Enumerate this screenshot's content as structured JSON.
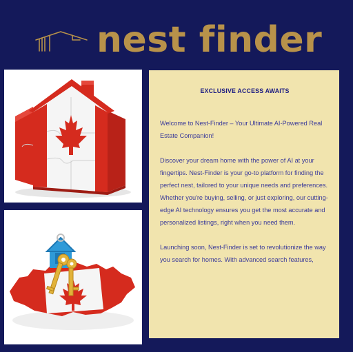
{
  "header": {
    "logo_icon": "house-outline-icon",
    "brand_name": "nest finder"
  },
  "images": [
    {
      "name": "canadian-flag-puzzle-house-image",
      "icon": "puzzle-house-canada-flag"
    },
    {
      "name": "canada-map-house-keys-image",
      "icon": "keys-on-canada-map"
    }
  ],
  "panel": {
    "heading": "EXCLUSIVE ACCESS AWAITS",
    "paragraphs": [
      "Welcome to Nest-Finder – Your Ultimate AI-Powered Real Estate Companion!",
      "Discover your dream home with the power of AI at your fingertips. Nest-Finder is your go-to platform for finding the perfect nest, tailored to your unique needs and preferences. Whether you're buying, selling, or just exploring, our cutting-edge AI technology ensures you get the most accurate and personalized listings, right when you need them.",
      "Launching soon, Nest-Finder is set to revolutionize the way you search for homes. With advanced search features,"
    ]
  },
  "colors": {
    "background": "#14195a",
    "brand_gold": "#b8924a",
    "panel_bg": "#f1e4ae",
    "panel_text": "#3a3a9a",
    "flag_red": "#d52b1e"
  }
}
